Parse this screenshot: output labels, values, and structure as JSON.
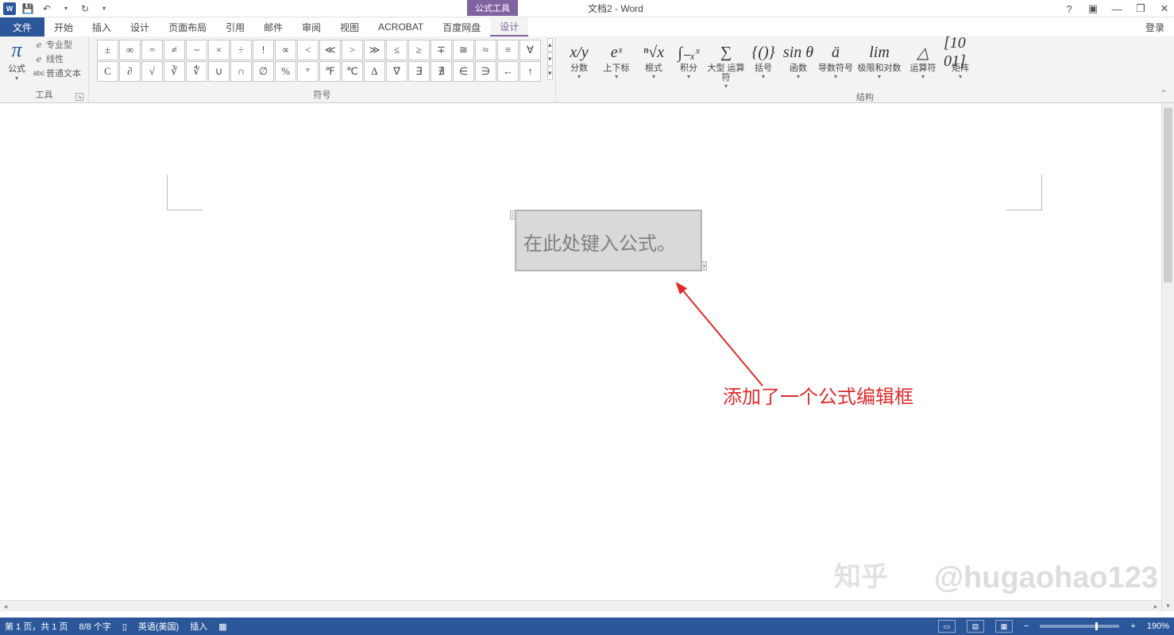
{
  "titlebar": {
    "app_icon_text": "W",
    "context_tab": "公式工具",
    "doc_title": "文档2 - Word",
    "help": "?",
    "ribbon_opts": "▣",
    "min": "—",
    "restore": "❐",
    "close": "✕"
  },
  "tabs": {
    "file": "文件",
    "items": [
      "开始",
      "插入",
      "设计",
      "页面布局",
      "引用",
      "邮件",
      "审阅",
      "视图",
      "ACROBAT",
      "百度网盘"
    ],
    "context_active": "设计",
    "login": "登录"
  },
  "ribbon": {
    "tools": {
      "equation": "公式",
      "professional": "专业型",
      "linear": "线性",
      "normal_text": "普通文本",
      "group": "工具"
    },
    "symbols": {
      "row1": [
        "±",
        "∞",
        "=",
        "≠",
        "~",
        "×",
        "÷",
        "!",
        "∝",
        "<",
        "≪",
        ">",
        "≫",
        "≤",
        "≥",
        "∓",
        "≅",
        "≈",
        "≡",
        "∀"
      ],
      "row2": [
        "C",
        "∂",
        "√",
        "∛",
        "∜",
        "∪",
        "∩",
        "∅",
        "%",
        "°",
        "℉",
        "℃",
        "∆",
        "∇",
        "∃",
        "∄",
        "∈",
        "∋",
        "←",
        "↑"
      ],
      "group": "符号"
    },
    "structures": {
      "items": [
        {
          "glyph": "x/y",
          "label": "分数"
        },
        {
          "glyph": "eˣ",
          "label": "上下标"
        },
        {
          "glyph": "ⁿ√x",
          "label": "根式"
        },
        {
          "glyph": "∫₋ₓˣ",
          "label": "积分"
        },
        {
          "glyph": "∑",
          "label": "大型\n运算符"
        },
        {
          "glyph": "{()}",
          "label": "括号"
        },
        {
          "glyph": "sin θ",
          "label": "函数"
        },
        {
          "glyph": "ä",
          "label": "导数符号"
        },
        {
          "glyph": "lim",
          "label": "极限和对数"
        },
        {
          "glyph": "△",
          "label": "运算符"
        },
        {
          "glyph": "[10\n01]",
          "label": "矩阵"
        }
      ],
      "group": "结构"
    }
  },
  "document": {
    "placeholder": "在此处键入公式。",
    "annotation": "添加了一个公式编辑框",
    "watermark_main": "@hugaohao123",
    "watermark_brand": "知乎"
  },
  "status": {
    "page": "第 1 页，共 1 页",
    "words": "8/8 个字",
    "proof_icon": "▯",
    "lang": "英语(美国)",
    "mode": "插入",
    "macro_icon": "▦",
    "zoom_minus": "−",
    "zoom_plus": "+",
    "zoom": "190%"
  }
}
